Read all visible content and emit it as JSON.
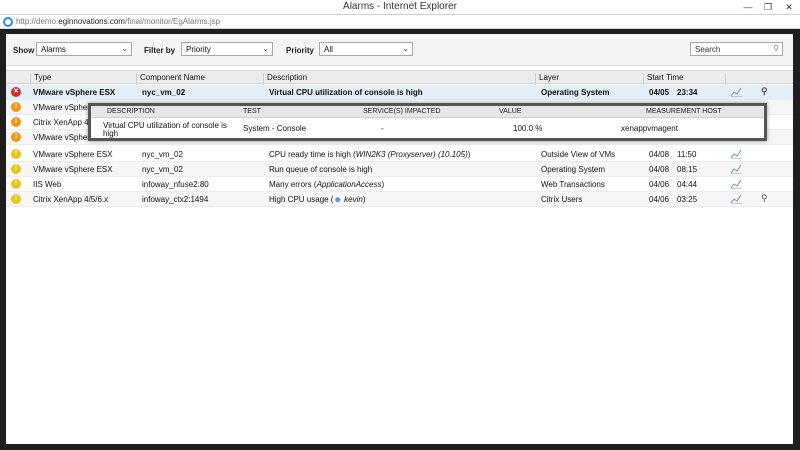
{
  "window": {
    "title": "Alarms - Internet Explorer",
    "url_prefix": "http://demo.",
    "url_host": "eginnovations.com",
    "url_path": "/final/monitor/EgAlarms.jsp"
  },
  "filters": {
    "show_label": "Show",
    "show_value": "Alarms",
    "filter_by_label": "Filter by",
    "filter_by_value": "Priority",
    "priority_label": "Priority",
    "priority_value": "All",
    "search_placeholder": "Search"
  },
  "table": {
    "columns": [
      "Type",
      "Component Name",
      "Description",
      "Layer",
      "Start Time"
    ],
    "rows": [
      {
        "severity": "critical",
        "type": "VMware vSphere ESX",
        "component": "nyc_vm_02",
        "description": "Virtual CPU utilization of console is high",
        "layer": "Operating System",
        "date": "04/05",
        "time": "23:34"
      },
      {
        "severity": "major",
        "type": "VMware vSphere",
        "component": "",
        "description": "",
        "layer": "",
        "date": "",
        "time": ""
      },
      {
        "severity": "major",
        "type": "Citrix XenApp 4,",
        "component": "",
        "description": "",
        "layer": "",
        "date": "",
        "time": ""
      },
      {
        "severity": "major",
        "type": "VMware vSphere",
        "component": "",
        "description": "",
        "layer": "",
        "date": "",
        "time": ""
      },
      {
        "severity": "minor",
        "type": "VMware vSphere ESX",
        "component": "nyc_vm_02",
        "desc_pre": "CPU ready time is high (",
        "desc_em": "WIN2K3 (Proxyserver) (10.105)",
        "desc_post": ")",
        "layer": "Outside View of VMs",
        "date": "04/08",
        "time": "11:50"
      },
      {
        "severity": "minor",
        "type": "VMware vSphere ESX",
        "component": "nyc_vm_02",
        "description": "Run queue of console is high",
        "layer": "Operating System",
        "date": "04/08",
        "time": "08:15"
      },
      {
        "severity": "minor",
        "type": "IIS Web",
        "component": "infoway_nfuse2:80",
        "desc_pre": "Many errors (",
        "desc_em": "ApplicationAccess",
        "desc_post": ")",
        "layer": "Web Transactions",
        "date": "04/06",
        "time": "04:44"
      },
      {
        "severity": "minor",
        "type": "Citrix XenApp 4/5/6.x",
        "component": "infoway_ctx2:1494",
        "desc_pre": "High CPU usage (",
        "desc_em": "kevin",
        "desc_post": ")",
        "layer": "Citrix Users",
        "date": "04/06",
        "time": "03:25"
      }
    ]
  },
  "popup": {
    "columns": [
      "DESCRIPTION",
      "TEST",
      "SERVICE(S) IMPACTED",
      "VALUE",
      "MEASUREMENT HOST"
    ],
    "description_line1": "Virtual CPU utilization of console is",
    "description_line2": "high",
    "test": "System - Console",
    "services": "-",
    "value": "100.0 %",
    "host": "xenappvmagent"
  },
  "colors": {
    "critical": "#c9302c",
    "major": "#f0961e",
    "minor": "#e7c51c"
  }
}
